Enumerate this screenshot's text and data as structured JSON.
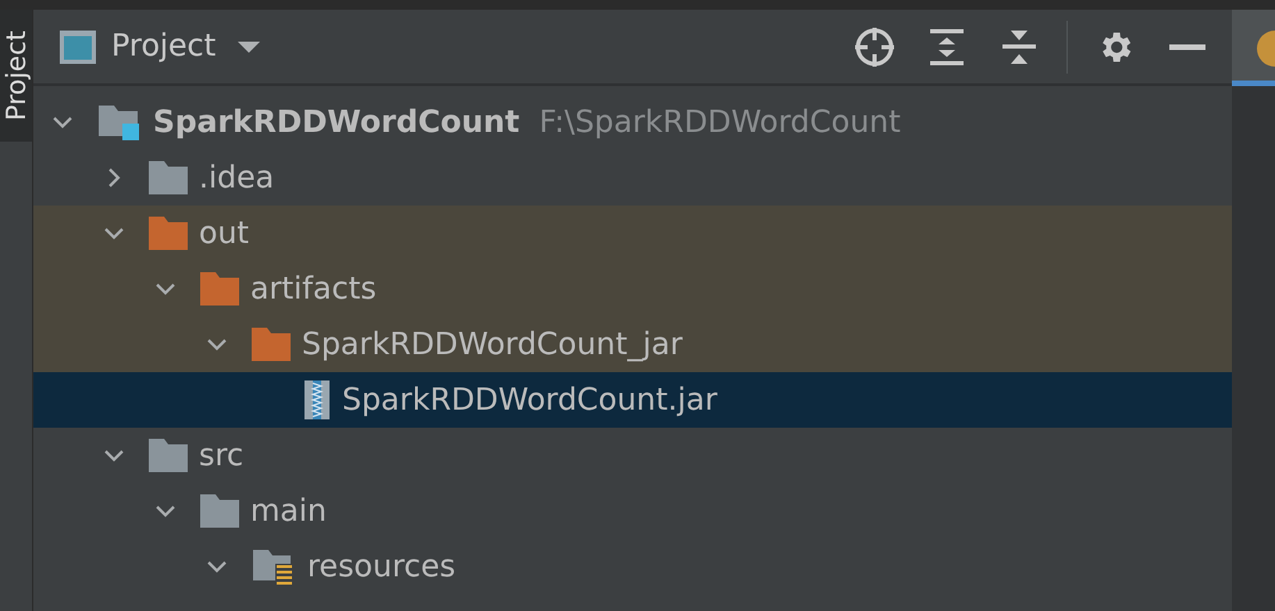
{
  "side_tab": {
    "label": "Project",
    "selected": true
  },
  "panel": {
    "title": "Project"
  },
  "tree": [
    {
      "kind": "module",
      "name": "SparkRDDWordCount",
      "path": "F:\\SparkRDDWordCount",
      "expanded": true,
      "excluded": false,
      "selected": false,
      "children": [
        {
          "kind": "folder",
          "name": ".idea",
          "expanded": false,
          "excluded": false,
          "selected": false
        },
        {
          "kind": "folder",
          "name": "out",
          "expanded": true,
          "excluded": true,
          "selected": false,
          "children": [
            {
              "kind": "folder",
              "name": "artifacts",
              "expanded": true,
              "excluded": true,
              "selected": false,
              "children": [
                {
                  "kind": "folder",
                  "name": "SparkRDDWordCount_jar",
                  "expanded": true,
                  "excluded": true,
                  "selected": false,
                  "children": [
                    {
                      "kind": "jar",
                      "name": "SparkRDDWordCount.jar",
                      "excluded": false,
                      "selected": true
                    }
                  ]
                }
              ]
            }
          ]
        },
        {
          "kind": "folder",
          "name": "src",
          "expanded": true,
          "excluded": false,
          "selected": false,
          "children": [
            {
              "kind": "folder",
              "name": "main",
              "expanded": true,
              "excluded": false,
              "selected": false,
              "children": [
                {
                  "kind": "resources",
                  "name": "resources",
                  "expanded": true,
                  "excluded": false,
                  "selected": false
                }
              ]
            }
          ]
        }
      ]
    }
  ]
}
